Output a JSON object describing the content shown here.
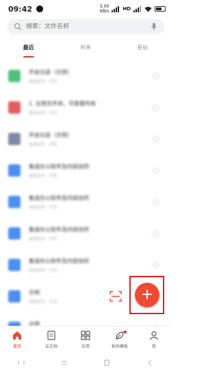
{
  "status_bar": {
    "time": "09:42",
    "speed_top": "5.00",
    "speed_bottom": "KB/s",
    "signal": "HD",
    "battery_level": 0.7
  },
  "search": {
    "placeholder": "搜索：文件名称"
  },
  "tabs": [
    {
      "label": "最近",
      "active": true
    },
    {
      "label": "共享",
      "active": false
    },
    {
      "label": "星标",
      "active": false
    }
  ],
  "notes": [
    {
      "title": "开会记录（示例）",
      "sub": "本地文件 · 今天",
      "color": "#4fc27a"
    },
    {
      "title": "1. 左侧文件夹，可查看所有",
      "sub": "本地文件 · 今天",
      "color": "#e25d5d"
    },
    {
      "title": "开会记录（示例）",
      "sub": "本地文件 · 今天",
      "color": "#7f8aa6"
    },
    {
      "title": "集成办公软件及内容协同",
      "sub": "本地文件 · 今天",
      "color": "#4d8ef0"
    },
    {
      "title": "集成办公软件及内容协同",
      "sub": "本地文件 · 今天",
      "color": "#4d8ef0"
    },
    {
      "title": "集成办公软件及内容协同",
      "sub": "本地文件 · 今天",
      "color": "#4d8ef0"
    },
    {
      "title": "集成办公软件及内容协同",
      "sub": "本地文件 · 今天",
      "color": "#4d8ef0"
    },
    {
      "title": "示例",
      "sub": "本地文件 · 今天",
      "color": "#4d8ef0"
    },
    {
      "title": "示例",
      "sub": "本地文件 · 今天",
      "color": "#4d8ef0"
    }
  ],
  "fab": {
    "label": "+"
  },
  "bottom_nav": [
    {
      "label": "首页",
      "icon": "home-icon",
      "active": true
    },
    {
      "label": "云文档",
      "icon": "document-icon",
      "active": false
    },
    {
      "label": "应用",
      "icon": "apps-grid-icon",
      "active": false
    },
    {
      "label": "稻壳模板",
      "icon": "leaf-icon",
      "active": false,
      "badge": true
    },
    {
      "label": "我",
      "icon": "person-icon",
      "active": false
    }
  ],
  "colors": {
    "accent": "#ef4b34",
    "highlight_frame": "#e02020"
  }
}
